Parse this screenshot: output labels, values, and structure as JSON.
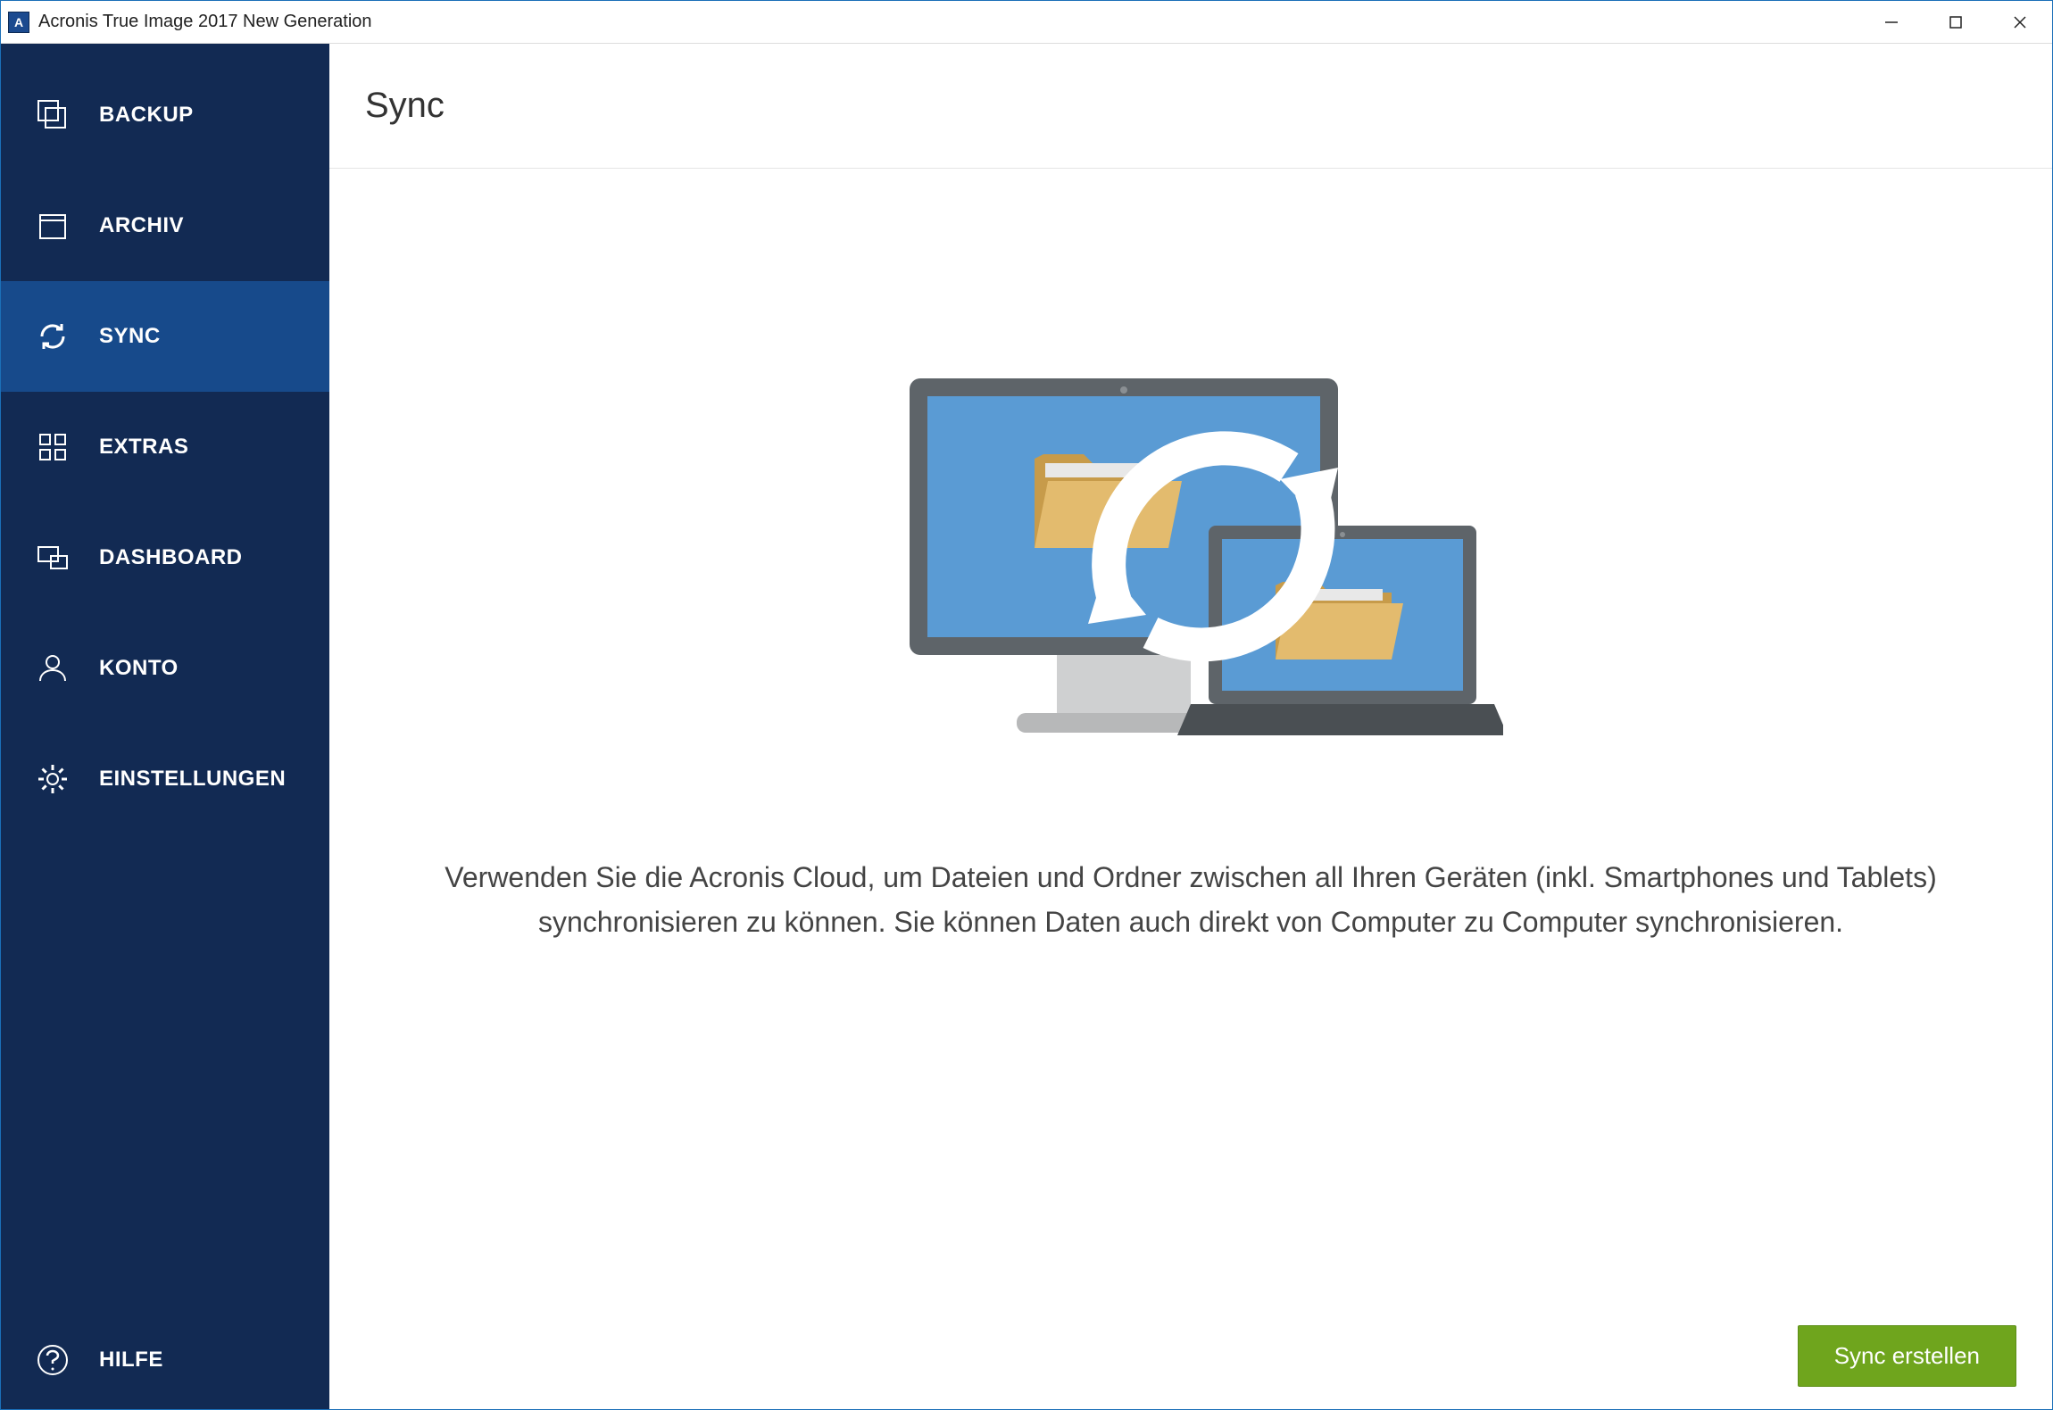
{
  "window": {
    "title": "Acronis True Image 2017 New Generation"
  },
  "sidebar": {
    "items": [
      {
        "label": "BACKUP",
        "icon": "backup-icon",
        "active": false
      },
      {
        "label": "ARCHIV",
        "icon": "archive-icon",
        "active": false
      },
      {
        "label": "SYNC",
        "icon": "sync-icon",
        "active": true
      },
      {
        "label": "EXTRAS",
        "icon": "extras-icon",
        "active": false
      },
      {
        "label": "DASHBOARD",
        "icon": "dashboard-icon",
        "active": false
      },
      {
        "label": "KONTO",
        "icon": "account-icon",
        "active": false
      },
      {
        "label": "EINSTELLUNGEN",
        "icon": "settings-icon",
        "active": false
      }
    ],
    "help": {
      "label": "HILFE",
      "icon": "help-icon"
    }
  },
  "main": {
    "title": "Sync",
    "description": "Verwenden Sie die Acronis Cloud, um Dateien und Ordner zwischen all Ihren Geräten (inkl. Smartphones und Tablets) synchronisieren zu können. Sie können Daten auch direkt von Computer zu Computer synchronisieren.",
    "primary_button": "Sync erstellen"
  }
}
